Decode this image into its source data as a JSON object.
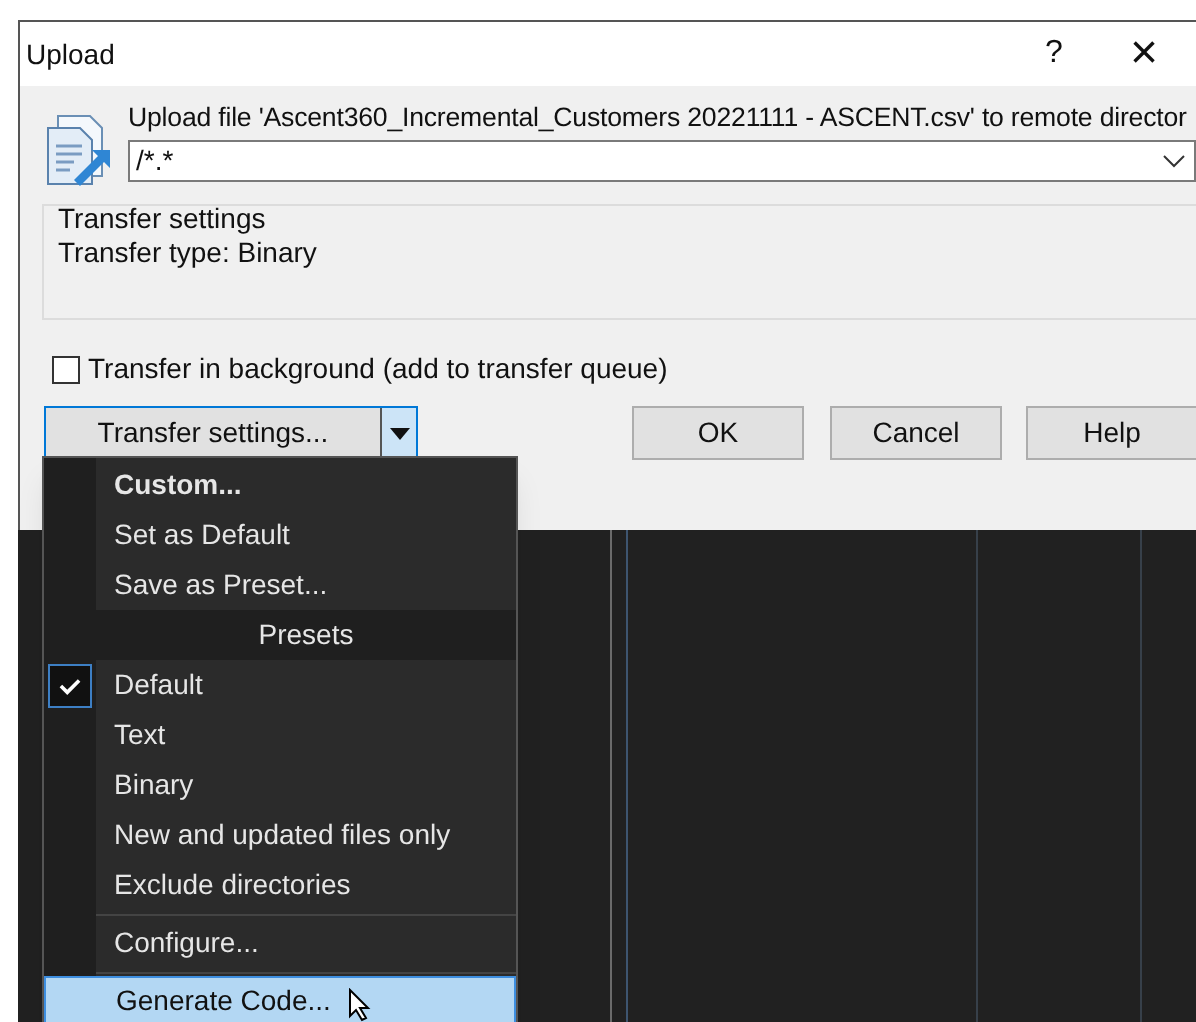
{
  "window": {
    "title": "Upload",
    "help_button": "?",
    "close_button": "×"
  },
  "message": "Upload file 'Ascent360_Incremental_Customers 20221111 - ASCENT.csv' to remote director",
  "target_field": {
    "value": "/*.*"
  },
  "transfer_settings_group": {
    "title": "Transfer settings",
    "lines": [
      "Transfer type: Binary"
    ]
  },
  "background_checkbox": {
    "label": "Transfer in background (add to transfer queue)",
    "checked": false
  },
  "transfer_settings_button": {
    "label": "Transfer settings...",
    "menu_open": true
  },
  "buttons": [
    "OK",
    "Cancel",
    "Help"
  ],
  "menu": {
    "items": [
      {
        "kind": "item",
        "label": "Custom...",
        "bold": true,
        "checked": false,
        "selected": false
      },
      {
        "kind": "item",
        "label": "Set as Default",
        "bold": false,
        "checked": false,
        "selected": false
      },
      {
        "kind": "item",
        "label": "Save as Preset...",
        "bold": false,
        "checked": false,
        "selected": false
      },
      {
        "kind": "header",
        "label": "Presets"
      },
      {
        "kind": "item",
        "label": "Default",
        "bold": false,
        "checked": true,
        "selected": false
      },
      {
        "kind": "item",
        "label": "Text",
        "bold": false,
        "checked": false,
        "selected": false
      },
      {
        "kind": "item",
        "label": "Binary",
        "bold": false,
        "checked": false,
        "selected": false
      },
      {
        "kind": "item",
        "label": "New and updated files only",
        "bold": false,
        "checked": false,
        "selected": false
      },
      {
        "kind": "item",
        "label": "Exclude directories",
        "bold": false,
        "checked": false,
        "selected": false
      },
      {
        "kind": "separator"
      },
      {
        "kind": "item",
        "label": "Configure...",
        "bold": false,
        "checked": false,
        "selected": false
      },
      {
        "kind": "separator"
      },
      {
        "kind": "item",
        "label": "Generate Code...",
        "bold": false,
        "checked": false,
        "selected": true
      }
    ]
  }
}
